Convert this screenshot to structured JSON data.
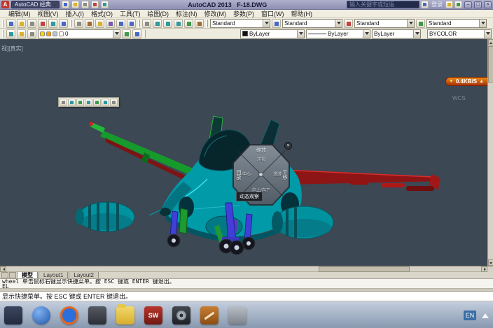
{
  "titlebar": {
    "logo_glyph": "A",
    "workspace_label": "AutoCAD 经典",
    "app_title": "AutoCAD 2013",
    "doc_name": "F-18.DWG",
    "search_placeholder": "输入关键字或短语",
    "signin_label": "登录",
    "min_glyph": "–",
    "max_glyph": "□",
    "close_glyph": "×"
  },
  "menubar": {
    "items": [
      "编辑(M)",
      "视图(V)",
      "插入(I)",
      "格式(O)",
      "工具(T)",
      "绘图(D)",
      "标注(N)",
      "修改(M)",
      "参数(P)",
      "窗口(W)",
      "帮助(H)"
    ]
  },
  "toolbars": {
    "style_combos": [
      "Standard",
      "Standard",
      "Standard",
      "Standard"
    ],
    "layer_value": "0",
    "color_value": "ByLayer",
    "linetype_value": "ByLayer",
    "lineweight_value": "ByLayer",
    "plotstyle_value": "BYCOLOR"
  },
  "canvas": {
    "viewport_label": "视][真实]",
    "wcs_label": "WCS",
    "net_badge": {
      "down_glyph": "▼",
      "speed": "0.4KB/S",
      "up_glyph": "▲"
    },
    "wheel": {
      "zoom": "缩放",
      "rewind": "回放",
      "pan": "平移",
      "orbit": "动态观察",
      "center": "中心",
      "walk": "漫游",
      "look": "环视",
      "updown": "向上/向下",
      "close_glyph": "×"
    }
  },
  "tabs": {
    "model": "模型",
    "layout1": "Layout1",
    "layout2": "Layout2"
  },
  "command": {
    "history1": "wheel 单击鼠标右键显示快捷菜单。按 ESC 键或 ENTER 键退出。",
    "history2": "EL",
    "prompt": "显示快捷菜单。按 ESC 键或 ENTER 键退出。"
  },
  "taskbar": {
    "sw_label": "SW",
    "lang": "EN"
  }
}
